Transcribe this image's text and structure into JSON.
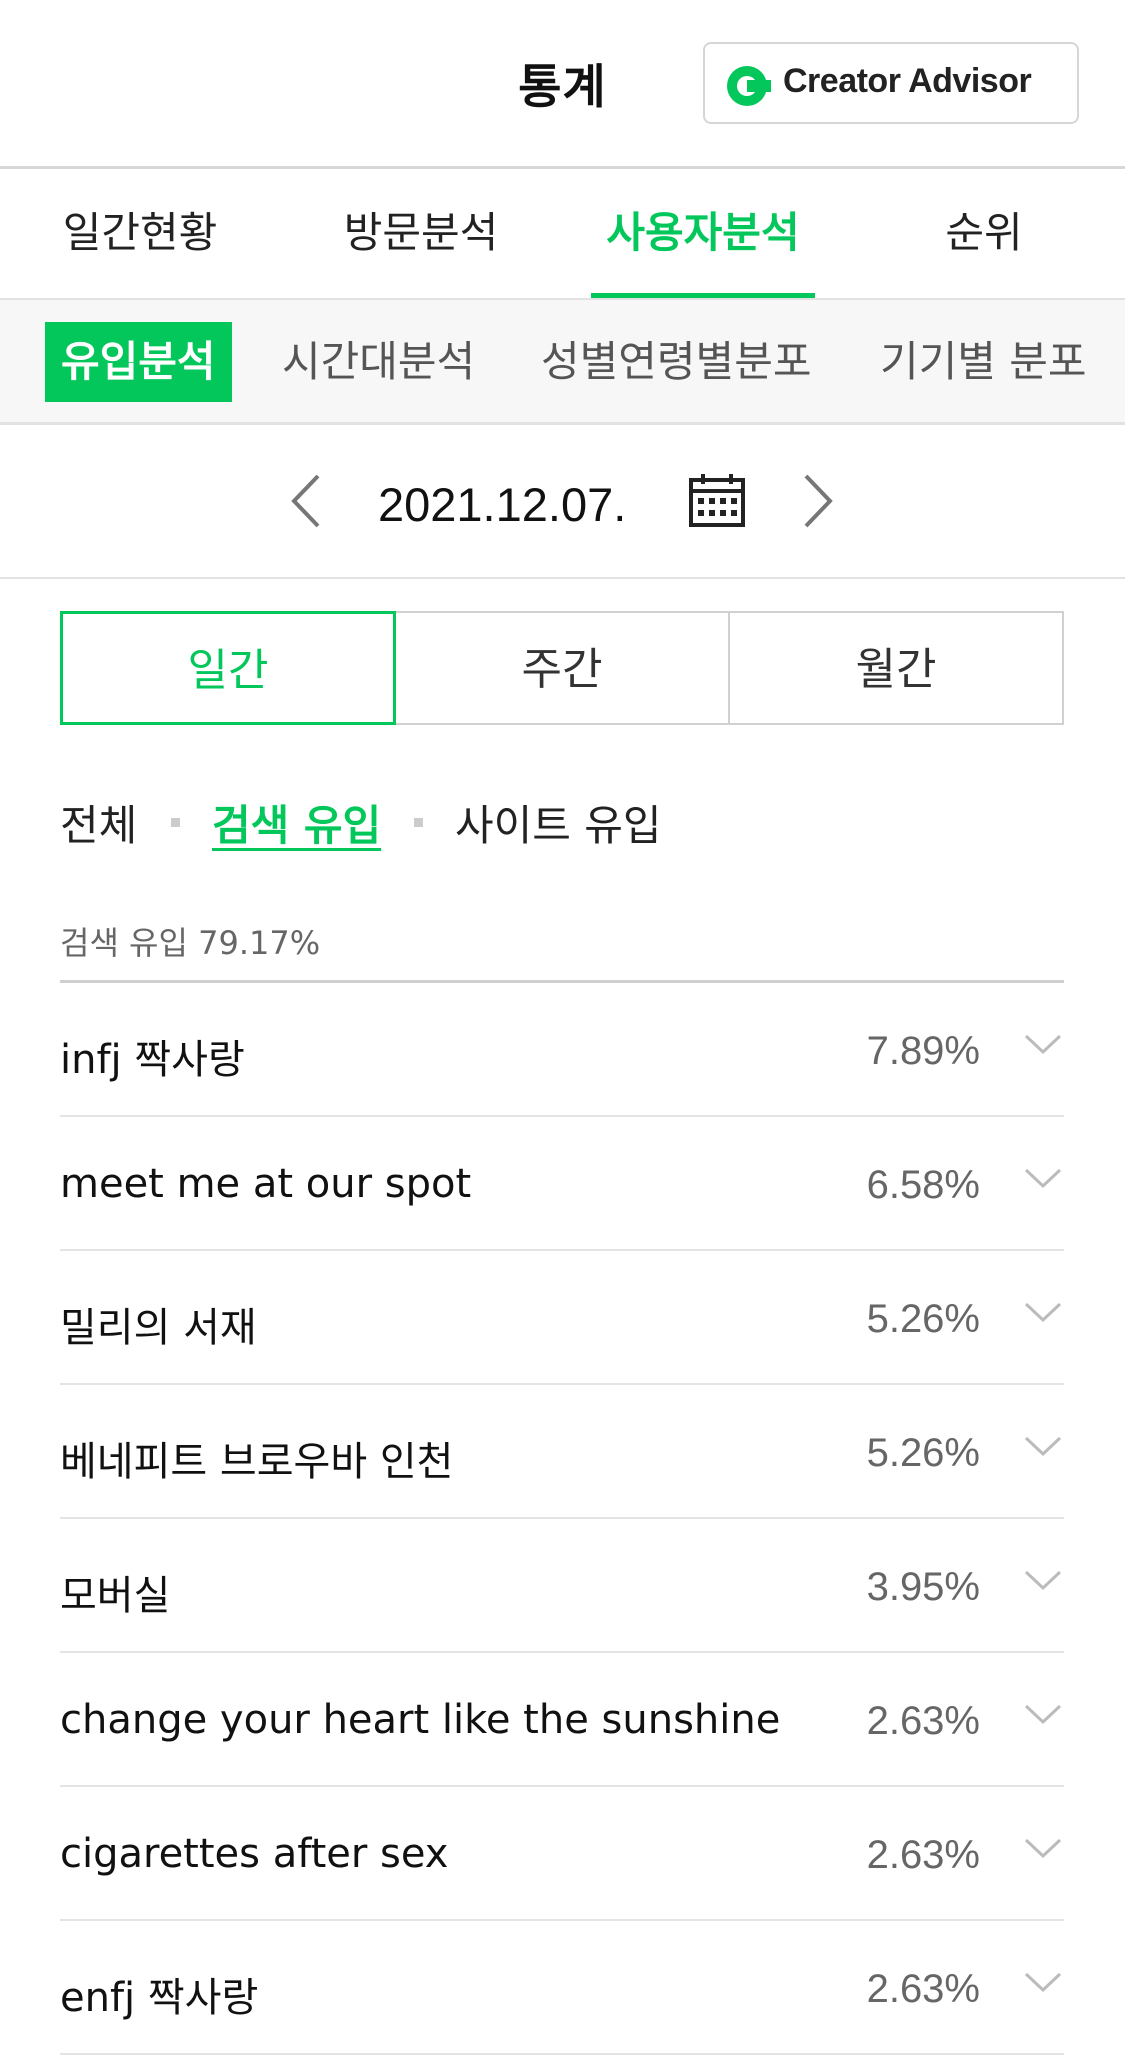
{
  "header": {
    "title": "통계",
    "creator_advisor_label": "Creator Advisor"
  },
  "main_tabs": [
    {
      "label": "일간현황",
      "active": false
    },
    {
      "label": "방문분석",
      "active": false
    },
    {
      "label": "사용자분석",
      "active": true
    },
    {
      "label": "순위",
      "active": false
    }
  ],
  "sub_tabs": [
    {
      "label": "유입분석",
      "active": true
    },
    {
      "label": "시간대분석",
      "active": false
    },
    {
      "label": "성별연령별분포",
      "active": false
    },
    {
      "label": "기기별 분포",
      "active": false
    }
  ],
  "date": {
    "value": "2021.12.07.",
    "prev_icon": "chevron-left-icon",
    "next_icon": "chevron-right-icon",
    "calendar_icon": "calendar-icon"
  },
  "period_buttons": [
    {
      "label": "일간",
      "active": true
    },
    {
      "label": "주간",
      "active": false
    },
    {
      "label": "월간",
      "active": false
    }
  ],
  "filters": [
    {
      "label": "전체",
      "active": false
    },
    {
      "label": "검색 유입",
      "active": true
    },
    {
      "label": "사이트 유입",
      "active": false
    }
  ],
  "summary": "검색 유입 79.17%",
  "keywords": [
    {
      "keyword": "infj 짝사랑",
      "percent": "7.89%"
    },
    {
      "keyword": "meet me at our spot",
      "percent": "6.58%"
    },
    {
      "keyword": "밀리의 서재",
      "percent": "5.26%"
    },
    {
      "keyword": "베네피트 브로우바 인천",
      "percent": "5.26%"
    },
    {
      "keyword": "모버실",
      "percent": "3.95%"
    },
    {
      "keyword": "change your heart like the sunshine",
      "percent": "2.63%"
    },
    {
      "keyword": "cigarettes after sex",
      "percent": "2.63%"
    },
    {
      "keyword": "enfj 짝사랑",
      "percent": "2.63%"
    }
  ],
  "colors": {
    "accent": "#03c75a",
    "text": "#111111",
    "muted": "#666666",
    "border": "#e4e4e4"
  }
}
